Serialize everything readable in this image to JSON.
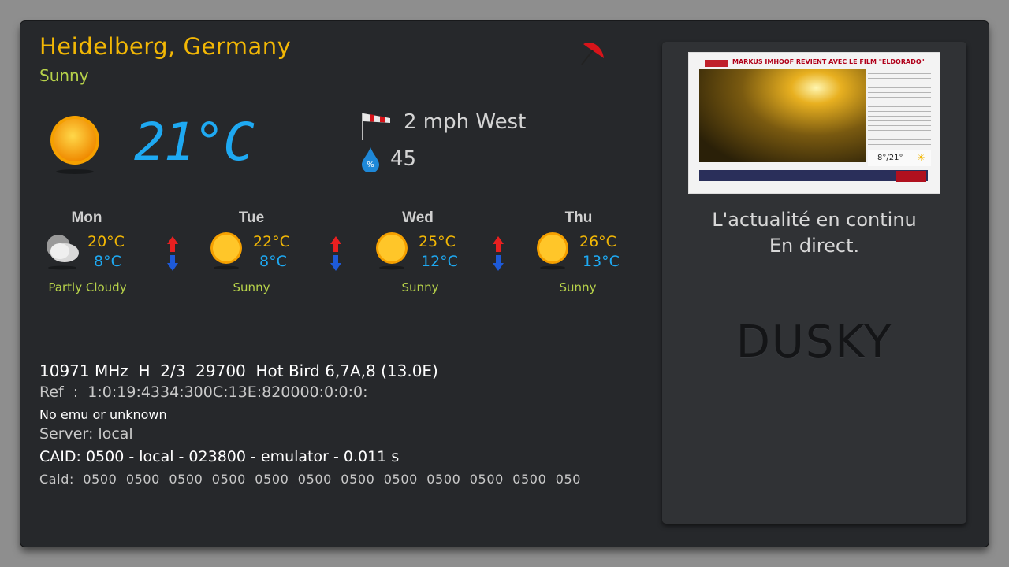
{
  "weather": {
    "location": "Heidelberg, Germany",
    "condition": "Sunny",
    "temperature": "21°C",
    "wind": "2 mph West",
    "humidity": "45",
    "humidity_icon_label": "%",
    "icons": {
      "current": "sun-icon",
      "umbrella": "umbrella-icon",
      "wind": "windsock-icon",
      "humidity": "water-drop-icon"
    }
  },
  "forecast": [
    {
      "day": "Mon",
      "high": "20°C",
      "low": "8°C",
      "condition": "Partly Cloudy",
      "icon": "partly-cloudy-icon"
    },
    {
      "day": "Tue",
      "high": "22°C",
      "low": "8°C",
      "condition": "Sunny",
      "icon": "sun-icon"
    },
    {
      "day": "Wed",
      "high": "25°C",
      "low": "12°C",
      "condition": "Sunny",
      "icon": "sun-icon"
    },
    {
      "day": "Thu",
      "high": "26°C",
      "low": "13°C",
      "condition": "Sunny",
      "icon": "sun-icon"
    }
  ],
  "service_info": {
    "transponder": "10971 MHz  H  2/3  29700  Hot Bird 6,7A,8 (13.0E)",
    "ref": "Ref  :  1:0:19:4334:300C:13E:820000:0:0:0:",
    "emu": "No emu or unknown",
    "server": "Server: local",
    "caid_line": "CAID: 0500 - local - 023800 - emulator - 0.011 s",
    "caid_list": "Caid:  0500  0500  0500  0500  0500  0500  0500  0500  0500  0500  0500  050"
  },
  "channel": {
    "preview_headline": "MARKUS IMHOOF REVIENT AVEC LE FILM \"ELDORADO\"",
    "preview_weather": "8°/21°",
    "tagline_line1": "L'actualité en continu",
    "tagline_line2": "En direct.",
    "skin_name": "DUSKY"
  },
  "colors": {
    "accent_yellow": "#f2b705",
    "accent_blue": "#1ea9f2",
    "condition_green": "#b7d24a",
    "panel": "#26282b"
  }
}
